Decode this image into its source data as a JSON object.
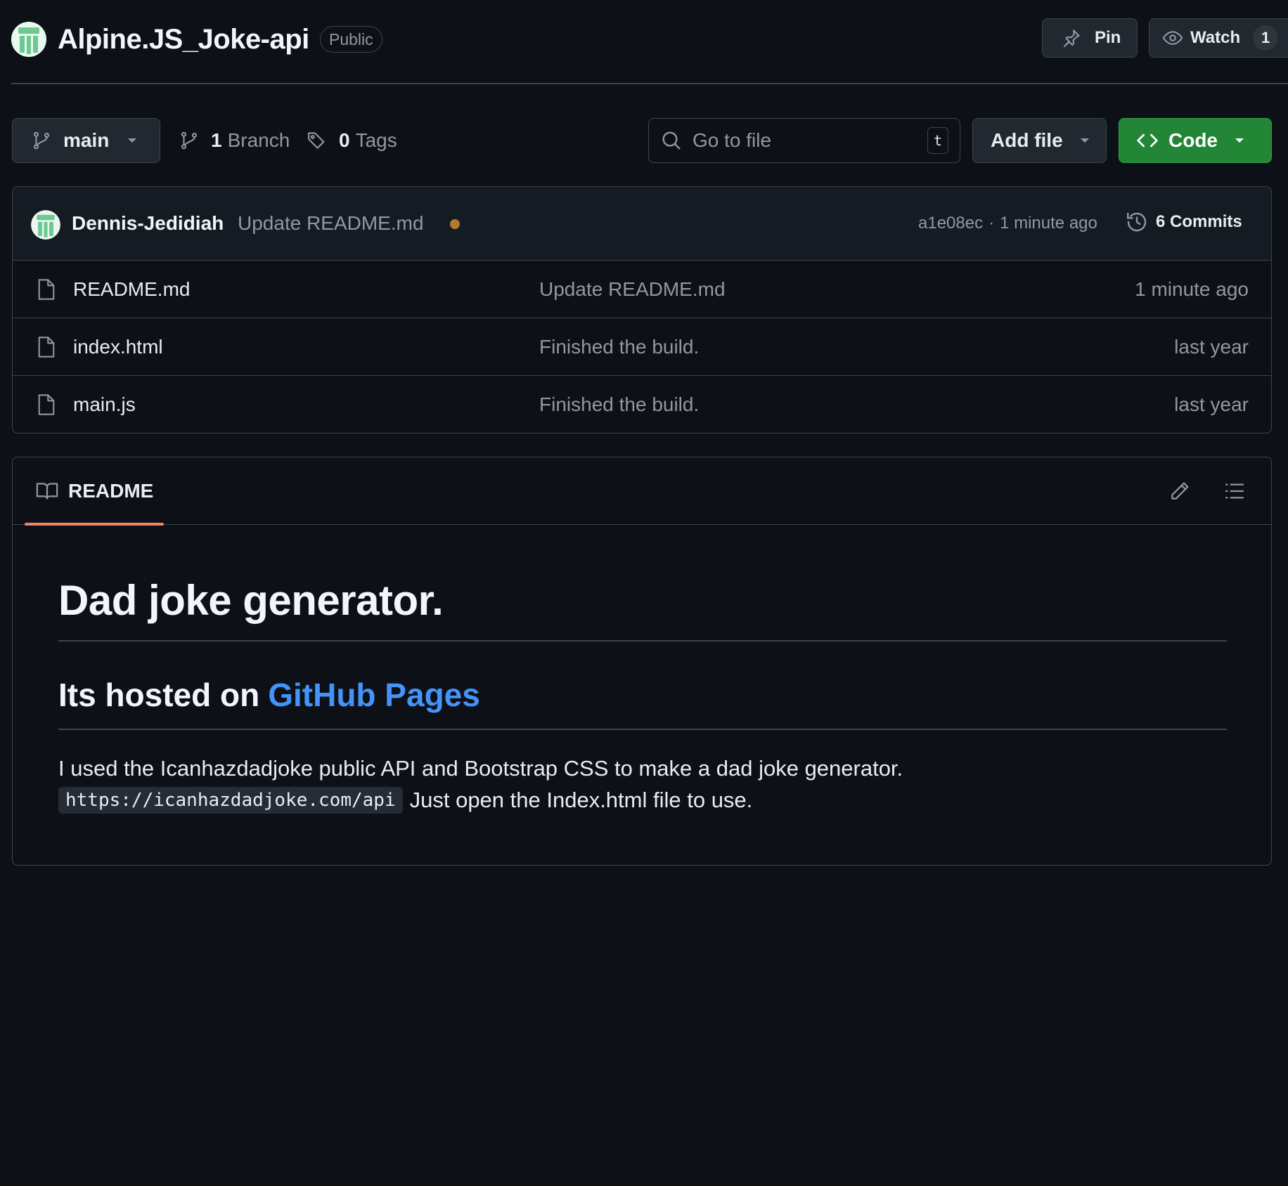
{
  "repo": {
    "name": "Alpine.JS_Joke-api",
    "visibility": "Public",
    "pin_label": "Pin",
    "watch_label": "Watch",
    "watch_count": "1"
  },
  "toolbar": {
    "branch_name": "main",
    "branch_count": "1",
    "branch_word": "Branch",
    "tag_count": "0",
    "tag_word": "Tags",
    "search_placeholder": "Go to file",
    "search_shortcut": "t",
    "add_file_label": "Add file",
    "code_label": "Code"
  },
  "commit": {
    "author": "Dennis-Jedidiah",
    "message": "Update README.md",
    "hash": "a1e08ec",
    "separator": "·",
    "time": "1 minute ago",
    "commits_label": "6 Commits"
  },
  "files": [
    {
      "name": "README.md",
      "message": "Update README.md",
      "time": "1 minute ago"
    },
    {
      "name": "index.html",
      "message": "Finished the build.",
      "time": "last year"
    },
    {
      "name": "main.js",
      "message": "Finished the build.",
      "time": "last year"
    }
  ],
  "readme": {
    "tab_label": "README",
    "h1": "Dad joke generator.",
    "h2_prefix": "Its hosted on",
    "h2_link": "GitHub Pages",
    "paragraph_line1": "I used the Icanhazdadjoke public API and Bootstrap CSS to make a dad joke generator.",
    "code": "https://icanhazdadjoke.com/api",
    "paragraph_line2": "Just open the Index.html file to use."
  },
  "colors": {
    "background": "#0d1117",
    "border": "#3d444d",
    "accent_green": "#238636",
    "link_blue": "#4493f8",
    "tab_underline": "#f78166",
    "status_dot": "#9e6a03"
  }
}
